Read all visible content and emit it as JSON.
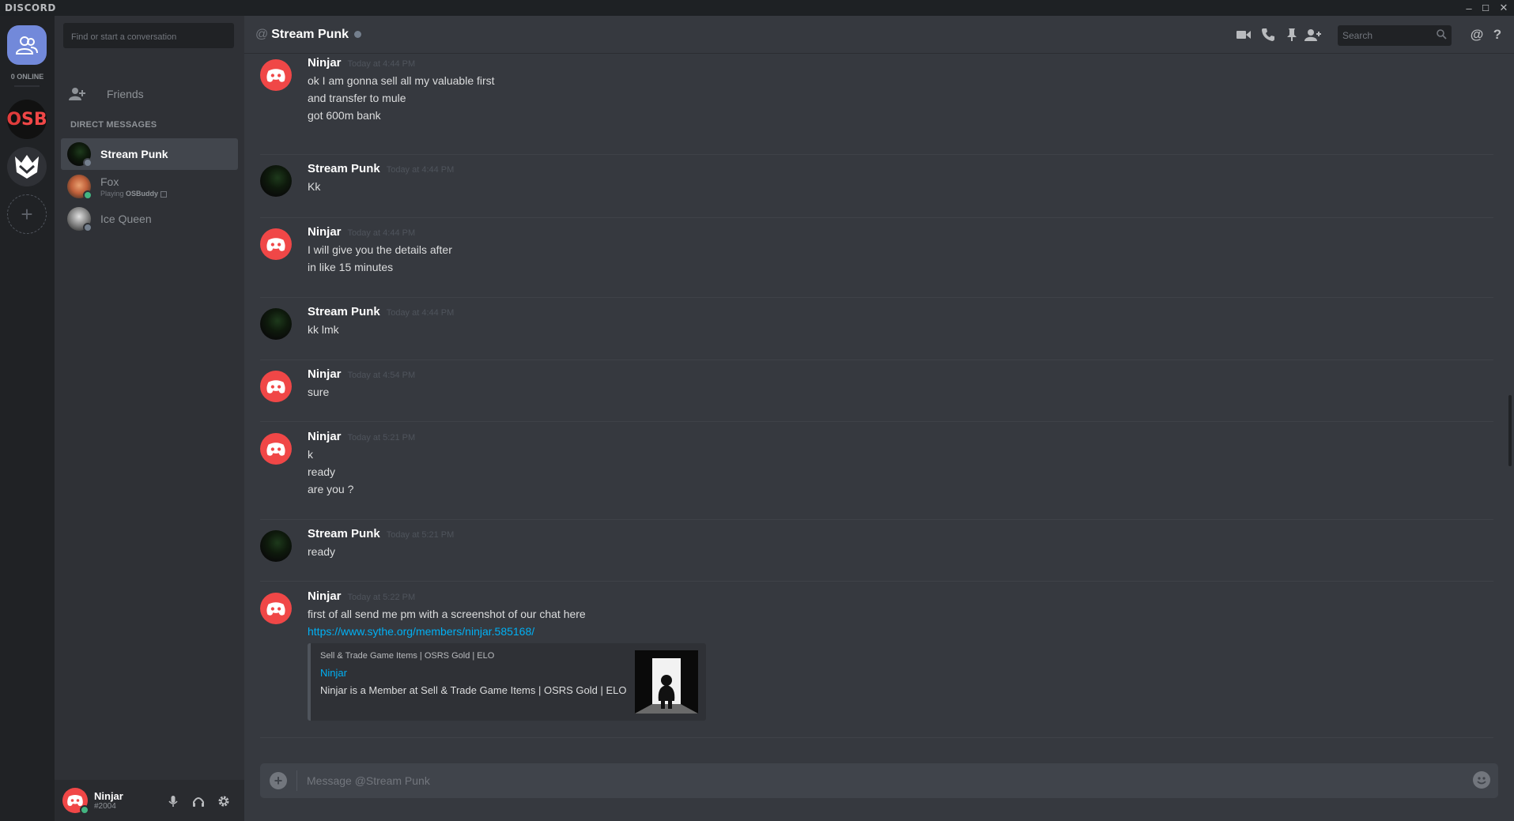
{
  "app": {
    "brand": "DISCORD"
  },
  "window": {
    "minimize": "–",
    "maximize": "☐",
    "close": "✕"
  },
  "rail": {
    "online_count": "0 ONLINE",
    "osb_letter1": "O",
    "osb_letters": "SB",
    "add": "+"
  },
  "sidebar": {
    "search_placeholder": "Find or start a conversation",
    "friends_label": "Friends",
    "dm_heading": "DIRECT MESSAGES",
    "dms": [
      {
        "name": "Stream Punk",
        "status_color": "#747f8d"
      },
      {
        "name": "Fox",
        "activity_prefix": "Playing",
        "activity_game": "OSBuddy",
        "status_color": "#43b581"
      },
      {
        "name": "Ice Queen",
        "status_color": "#747f8d"
      }
    ]
  },
  "user_panel": {
    "username": "Ninjar",
    "discriminator": "#2004"
  },
  "header": {
    "title": "Stream Punk",
    "search_placeholder": "Search"
  },
  "messages": [
    {
      "author": "Ninjar",
      "time": "Today at 4:44 PM",
      "avatar": "discord-red",
      "lines": [
        "ok I am gonna sell all my valuable first",
        "and transfer to mule",
        "got 600m bank"
      ]
    },
    {
      "author": "Stream Punk",
      "time": "Today at 4:44 PM",
      "avatar": "hooded",
      "lines": [
        "Kk"
      ]
    },
    {
      "author": "Ninjar",
      "time": "Today at 4:44 PM",
      "avatar": "discord-red",
      "lines": [
        "I will give you the details after",
        "in like 15 minutes"
      ]
    },
    {
      "author": "Stream Punk",
      "time": "Today at 4:44 PM",
      "avatar": "hooded",
      "lines": [
        "kk lmk"
      ]
    },
    {
      "author": "Ninjar",
      "time": "Today at 4:54 PM",
      "avatar": "discord-red",
      "lines": [
        "sure"
      ]
    },
    {
      "author": "Ninjar",
      "time": "Today at 5:21 PM",
      "avatar": "discord-red",
      "lines": [
        "k",
        "ready",
        "are you ?"
      ]
    },
    {
      "author": "Stream Punk",
      "time": "Today at 5:21 PM",
      "avatar": "hooded",
      "lines": [
        "ready"
      ]
    },
    {
      "author": "Ninjar",
      "time": "Today at 5:22 PM",
      "avatar": "discord-red",
      "lines": [
        "first of all send me pm with a screenshot of our chat here"
      ],
      "link": "https://www.sythe.org/members/ninjar.585168/",
      "embed": {
        "provider": "Sell & Trade Game Items | OSRS Gold | ELO",
        "title": "Ninjar",
        "description": "Ninjar is a Member at Sell & Trade Game Items | OSRS Gold | ELO"
      }
    }
  ],
  "composer": {
    "placeholder": "Message @Stream Punk"
  },
  "colors": {
    "accent": "#7289da",
    "link": "#00b0f4",
    "online": "#43b581",
    "danger": "#f04747"
  }
}
